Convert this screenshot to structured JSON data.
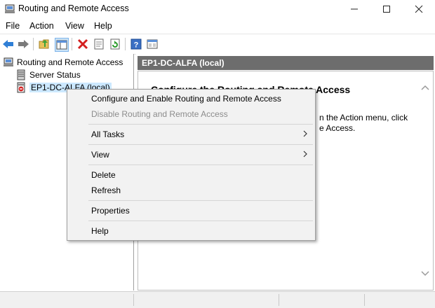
{
  "window": {
    "title": "Routing and Remote Access"
  },
  "menubar": {
    "items": [
      "File",
      "Action",
      "View",
      "Help"
    ]
  },
  "toolbar": {
    "icons": [
      "back-arrow-icon",
      "forward-arrow-icon",
      "up-folder-icon",
      "show-hide-tree-icon",
      "delete-icon",
      "properties-icon",
      "refresh-icon",
      "help-icon",
      "mmc-view-icon"
    ]
  },
  "tree": {
    "root": "Routing and Remote Access",
    "items": [
      "Server Status",
      "EP1-DC-ALFA (local)"
    ]
  },
  "detail": {
    "header": "EP1-DC-ALFA (local)",
    "heading": "Configure the Routing and Remote Access",
    "text_line1": "n the Action menu, click",
    "text_line2": "e Access."
  },
  "context_menu": {
    "configure": "Configure and Enable Routing and Remote Access",
    "disable": "Disable Routing and Remote Access",
    "all_tasks": "All Tasks",
    "view": "View",
    "delete": "Delete",
    "refresh": "Refresh",
    "properties": "Properties",
    "help": "Help"
  },
  "colors": {
    "accent_blue": "#1f6fd0",
    "delete_red": "#d42020",
    "header_gray": "#6d6d6d",
    "selection": "#cce8ff"
  }
}
